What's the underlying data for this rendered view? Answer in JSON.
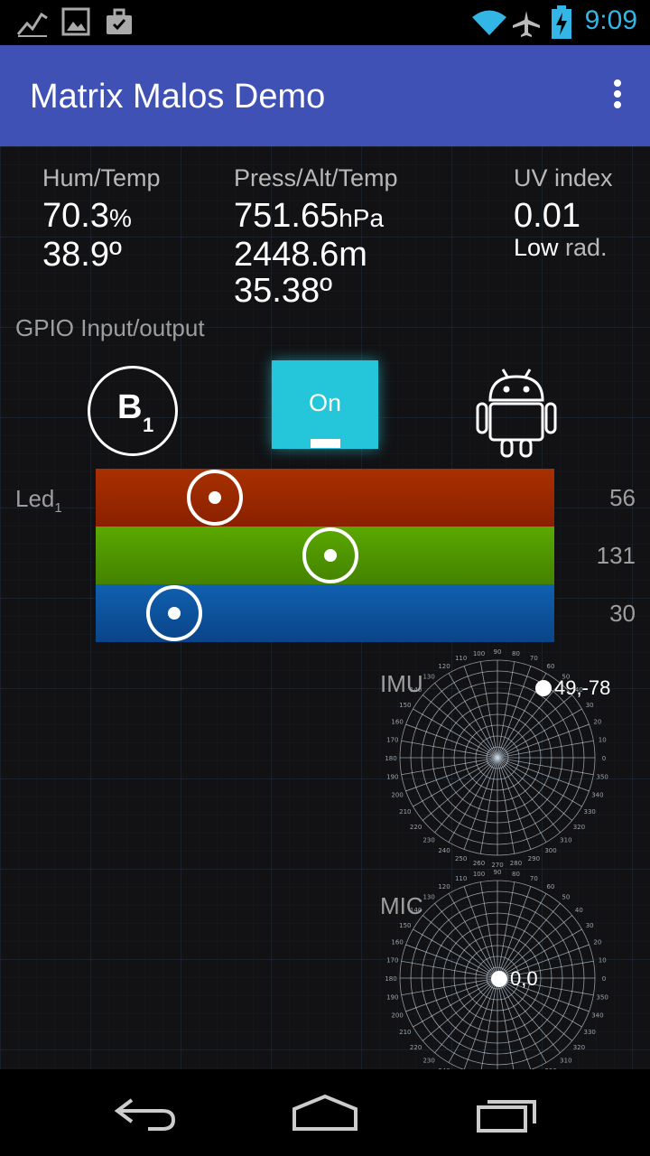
{
  "status_bar": {
    "time": "9:09",
    "left_icons": [
      "chart-icon",
      "image-icon",
      "briefcase-icon"
    ],
    "right_icons": [
      "wifi-icon",
      "airplane-icon",
      "battery-charging-icon"
    ],
    "clock_color": "#33b5e5"
  },
  "app_bar": {
    "title": "Matrix Malos Demo",
    "color": "#3f51b5",
    "overflow_icon": "more-vert-icon"
  },
  "sensors": {
    "hum_temp": {
      "label": "Hum/Temp",
      "humidity": "70.3",
      "humidity_unit": "%",
      "temperature": "38.9º"
    },
    "press_alt_temp": {
      "label": "Press/Alt/Temp",
      "pressure": "751.65",
      "pressure_unit": "hPa",
      "altitude": "2448.6m",
      "temperature": "35.38º"
    },
    "uv": {
      "label": "UV index",
      "value": "0.01",
      "level_a": "Low",
      "level_b": " rad."
    }
  },
  "gpio": {
    "title": "GPIO Input/output",
    "button_letter": "B",
    "button_sub": "1",
    "toggle_label": "On",
    "toggle_color": "#26c6da"
  },
  "led": {
    "label": "Led",
    "label_sub": "1",
    "channels": [
      {
        "name": "red",
        "value": "56",
        "level": 56,
        "color": "#9a2600"
      },
      {
        "name": "green",
        "value": "131",
        "level": 131,
        "color": "#4e9400"
      },
      {
        "name": "blue",
        "value": "30",
        "level": 30,
        "color": "#0d4f9b"
      }
    ],
    "max": 255
  },
  "imu": {
    "label": "IMU",
    "point_label": "49,-78",
    "angle_labels": [
      "0",
      "10",
      "20",
      "30",
      "40",
      "50",
      "60",
      "70",
      "80",
      "90",
      "100",
      "110",
      "120",
      "130",
      "140",
      "150",
      "160",
      "170",
      "180",
      "190",
      "200",
      "210",
      "220",
      "230",
      "240",
      "250",
      "260",
      "270",
      "280",
      "290",
      "300",
      "310",
      "320",
      "330",
      "340",
      "350"
    ]
  },
  "mic": {
    "label": "MIC",
    "point_label": "0,0"
  },
  "nav_bar": {
    "buttons": [
      "back-icon",
      "home-icon",
      "recents-icon"
    ]
  }
}
